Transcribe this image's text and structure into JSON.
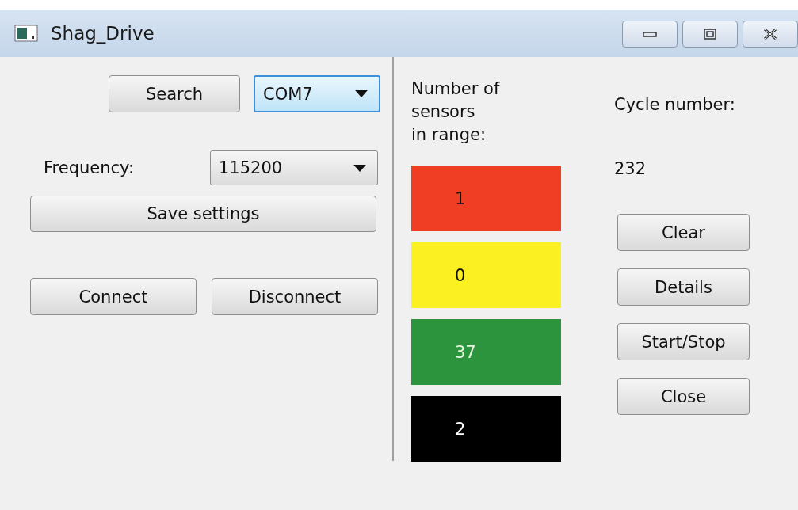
{
  "window": {
    "title": "Shag_Drive"
  },
  "port": {
    "search_button": "Search",
    "port_select": {
      "value": "COM7",
      "focused": true
    }
  },
  "frequency": {
    "label": "Frequency:",
    "select": {
      "value": "115200",
      "focused": false
    }
  },
  "save_button": "Save settings",
  "connection_buttons": [
    "Connect",
    "Disconnect"
  ],
  "sensors": {
    "label": "Number of\nsensors\nin range:",
    "counts": [
      {
        "value": "1",
        "color": "#f03e24"
      },
      {
        "value": "0",
        "color": "#fbf022"
      },
      {
        "value": "37",
        "color": "#2c943d"
      },
      {
        "value": "2",
        "color": "#000000"
      }
    ]
  },
  "cycle": {
    "label": "Cycle number:",
    "value": "232"
  },
  "action_buttons": [
    "Clear",
    "Details",
    "Start/Stop",
    "Close"
  ]
}
